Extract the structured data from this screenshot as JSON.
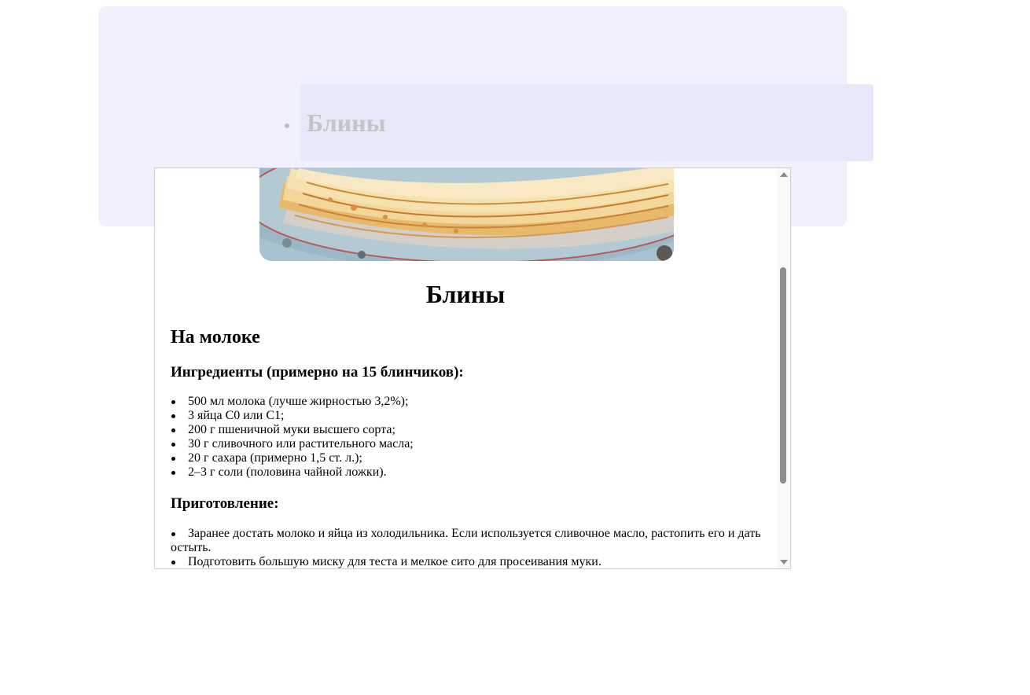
{
  "menu": {
    "items": [
      {
        "label": "Блины"
      }
    ]
  },
  "recipe": {
    "image_alt": "pancakes-photo",
    "title": "Блины",
    "section_title": "На молоке",
    "ingredients_title": "Ингредиенты (примерно на 15 блинчиков):",
    "ingredients": [
      "500 мл молока (лучше жирностью 3,2%);",
      "3 яйца С0 или С1;",
      "200 г пшеничной муки высшего сорта;",
      "30 г сливочного или растительного масла;",
      "20 г сахара (примерно 1,5 ст. л.);",
      "2–3 г соли (половина чайной ложки)."
    ],
    "steps_title": "Приготовление:",
    "steps": [
      "Заранее достать молоко и яйца из холодильника. Если используется сливочное масло, растопить его и дать остыть.",
      "Подготовить большую миску для теста и мелкое сито для просеивания муки."
    ]
  },
  "colors": {
    "panel_bg": "#f1f0fe",
    "menu_bg": "#e8e8fb",
    "menu_text": "#c4c4c4",
    "scroll_thumb": "#8d8d8d"
  }
}
